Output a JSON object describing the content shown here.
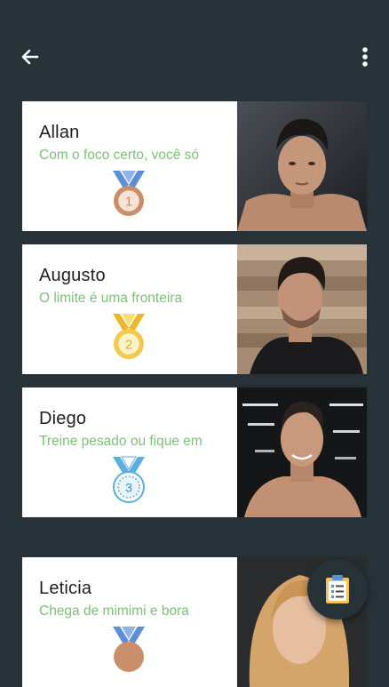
{
  "toolbar": {
    "back_icon": "arrow-left-icon",
    "menu_icon": "more-vertical-icon"
  },
  "trainers": [
    {
      "name": "Allan",
      "motto": "Com o foco certo, você só",
      "medal": "1",
      "medal_color": "#c98f6b"
    },
    {
      "name": "Augusto",
      "motto": "O limite é uma fronteira",
      "medal": "2",
      "medal_color": "#f2c94c"
    },
    {
      "name": "Diego",
      "motto": "Treine pesado ou fique em",
      "medal": "3",
      "medal_color": "#5aaee0"
    },
    {
      "name": "Leticia",
      "motto": "Chega de mimimi e bora",
      "medal": "",
      "medal_color": "#c98f6b"
    }
  ],
  "fab": {
    "icon": "clipboard-icon"
  },
  "colors": {
    "background": "#263238",
    "card": "#ffffff",
    "motto": "#7fbf7a",
    "ribbon": "#5d8fd6"
  }
}
